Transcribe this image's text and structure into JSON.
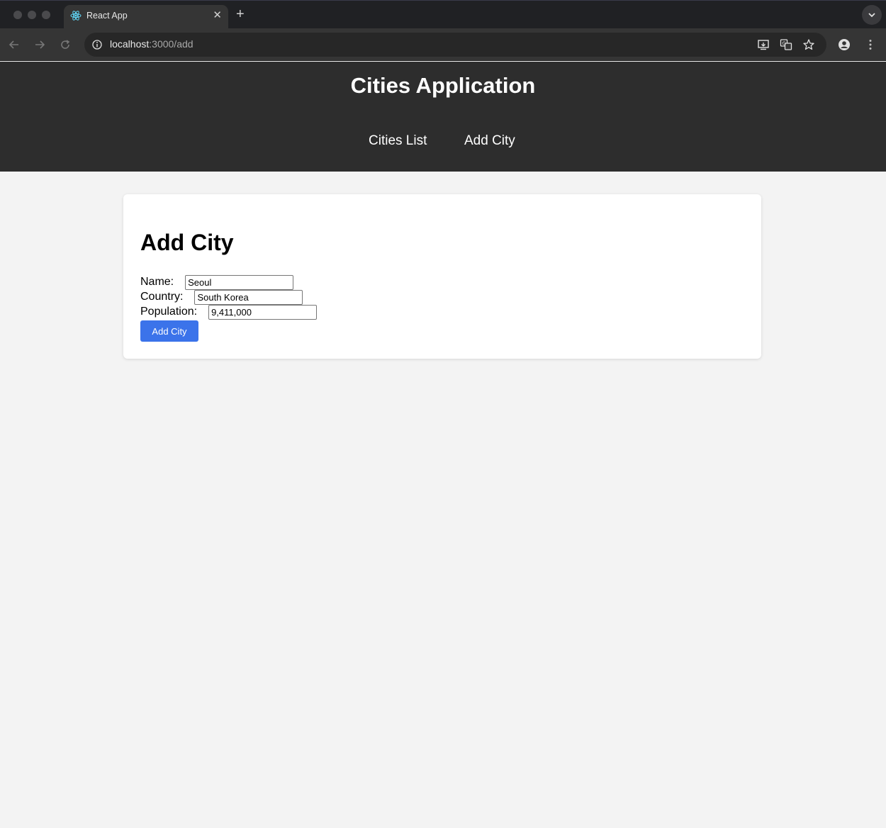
{
  "browser": {
    "tab_title": "React App",
    "tab_close": "✕",
    "new_tab": "+",
    "url_host": "localhost",
    "url_path": ":3000/add"
  },
  "header": {
    "title": "Cities Application",
    "nav": [
      "Cities List",
      "Add City"
    ]
  },
  "form": {
    "heading": "Add City",
    "fields": [
      {
        "label": "Name:",
        "value": "Seoul"
      },
      {
        "label": "Country:",
        "value": "South Korea"
      },
      {
        "label": "Population:",
        "value": "9,411,000"
      }
    ],
    "submit_label": "Add City"
  },
  "colors": {
    "header_bg": "#2d2d2d",
    "button_bg": "#3b73ea",
    "page_bg": "#f3f3f3"
  },
  "icons": [
    "react-icon",
    "back-arrow-icon",
    "forward-arrow-icon",
    "reload-icon",
    "site-info-icon",
    "install-app-icon",
    "translate-icon",
    "star-icon",
    "profile-icon",
    "menu-dots-icon"
  ]
}
